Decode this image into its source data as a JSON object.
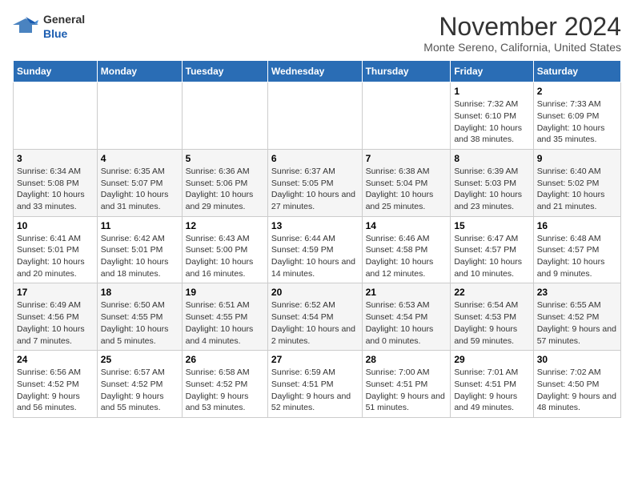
{
  "header": {
    "logo_general": "General",
    "logo_blue": "Blue",
    "title": "November 2024",
    "subtitle": "Monte Sereno, California, United States"
  },
  "days_of_week": [
    "Sunday",
    "Monday",
    "Tuesday",
    "Wednesday",
    "Thursday",
    "Friday",
    "Saturday"
  ],
  "weeks": [
    [
      {
        "num": "",
        "info": ""
      },
      {
        "num": "",
        "info": ""
      },
      {
        "num": "",
        "info": ""
      },
      {
        "num": "",
        "info": ""
      },
      {
        "num": "",
        "info": ""
      },
      {
        "num": "1",
        "info": "Sunrise: 7:32 AM\nSunset: 6:10 PM\nDaylight: 10 hours and 38 minutes."
      },
      {
        "num": "2",
        "info": "Sunrise: 7:33 AM\nSunset: 6:09 PM\nDaylight: 10 hours and 35 minutes."
      }
    ],
    [
      {
        "num": "3",
        "info": "Sunrise: 6:34 AM\nSunset: 5:08 PM\nDaylight: 10 hours and 33 minutes."
      },
      {
        "num": "4",
        "info": "Sunrise: 6:35 AM\nSunset: 5:07 PM\nDaylight: 10 hours and 31 minutes."
      },
      {
        "num": "5",
        "info": "Sunrise: 6:36 AM\nSunset: 5:06 PM\nDaylight: 10 hours and 29 minutes."
      },
      {
        "num": "6",
        "info": "Sunrise: 6:37 AM\nSunset: 5:05 PM\nDaylight: 10 hours and 27 minutes."
      },
      {
        "num": "7",
        "info": "Sunrise: 6:38 AM\nSunset: 5:04 PM\nDaylight: 10 hours and 25 minutes."
      },
      {
        "num": "8",
        "info": "Sunrise: 6:39 AM\nSunset: 5:03 PM\nDaylight: 10 hours and 23 minutes."
      },
      {
        "num": "9",
        "info": "Sunrise: 6:40 AM\nSunset: 5:02 PM\nDaylight: 10 hours and 21 minutes."
      }
    ],
    [
      {
        "num": "10",
        "info": "Sunrise: 6:41 AM\nSunset: 5:01 PM\nDaylight: 10 hours and 20 minutes."
      },
      {
        "num": "11",
        "info": "Sunrise: 6:42 AM\nSunset: 5:01 PM\nDaylight: 10 hours and 18 minutes."
      },
      {
        "num": "12",
        "info": "Sunrise: 6:43 AM\nSunset: 5:00 PM\nDaylight: 10 hours and 16 minutes."
      },
      {
        "num": "13",
        "info": "Sunrise: 6:44 AM\nSunset: 4:59 PM\nDaylight: 10 hours and 14 minutes."
      },
      {
        "num": "14",
        "info": "Sunrise: 6:46 AM\nSunset: 4:58 PM\nDaylight: 10 hours and 12 minutes."
      },
      {
        "num": "15",
        "info": "Sunrise: 6:47 AM\nSunset: 4:57 PM\nDaylight: 10 hours and 10 minutes."
      },
      {
        "num": "16",
        "info": "Sunrise: 6:48 AM\nSunset: 4:57 PM\nDaylight: 10 hours and 9 minutes."
      }
    ],
    [
      {
        "num": "17",
        "info": "Sunrise: 6:49 AM\nSunset: 4:56 PM\nDaylight: 10 hours and 7 minutes."
      },
      {
        "num": "18",
        "info": "Sunrise: 6:50 AM\nSunset: 4:55 PM\nDaylight: 10 hours and 5 minutes."
      },
      {
        "num": "19",
        "info": "Sunrise: 6:51 AM\nSunset: 4:55 PM\nDaylight: 10 hours and 4 minutes."
      },
      {
        "num": "20",
        "info": "Sunrise: 6:52 AM\nSunset: 4:54 PM\nDaylight: 10 hours and 2 minutes."
      },
      {
        "num": "21",
        "info": "Sunrise: 6:53 AM\nSunset: 4:54 PM\nDaylight: 10 hours and 0 minutes."
      },
      {
        "num": "22",
        "info": "Sunrise: 6:54 AM\nSunset: 4:53 PM\nDaylight: 9 hours and 59 minutes."
      },
      {
        "num": "23",
        "info": "Sunrise: 6:55 AM\nSunset: 4:52 PM\nDaylight: 9 hours and 57 minutes."
      }
    ],
    [
      {
        "num": "24",
        "info": "Sunrise: 6:56 AM\nSunset: 4:52 PM\nDaylight: 9 hours and 56 minutes."
      },
      {
        "num": "25",
        "info": "Sunrise: 6:57 AM\nSunset: 4:52 PM\nDaylight: 9 hours and 55 minutes."
      },
      {
        "num": "26",
        "info": "Sunrise: 6:58 AM\nSunset: 4:52 PM\nDaylight: 9 hours and 53 minutes."
      },
      {
        "num": "27",
        "info": "Sunrise: 6:59 AM\nSunset: 4:51 PM\nDaylight: 9 hours and 52 minutes."
      },
      {
        "num": "28",
        "info": "Sunrise: 7:00 AM\nSunset: 4:51 PM\nDaylight: 9 hours and 51 minutes."
      },
      {
        "num": "29",
        "info": "Sunrise: 7:01 AM\nSunset: 4:51 PM\nDaylight: 9 hours and 49 minutes."
      },
      {
        "num": "30",
        "info": "Sunrise: 7:02 AM\nSunset: 4:50 PM\nDaylight: 9 hours and 48 minutes."
      }
    ]
  ]
}
